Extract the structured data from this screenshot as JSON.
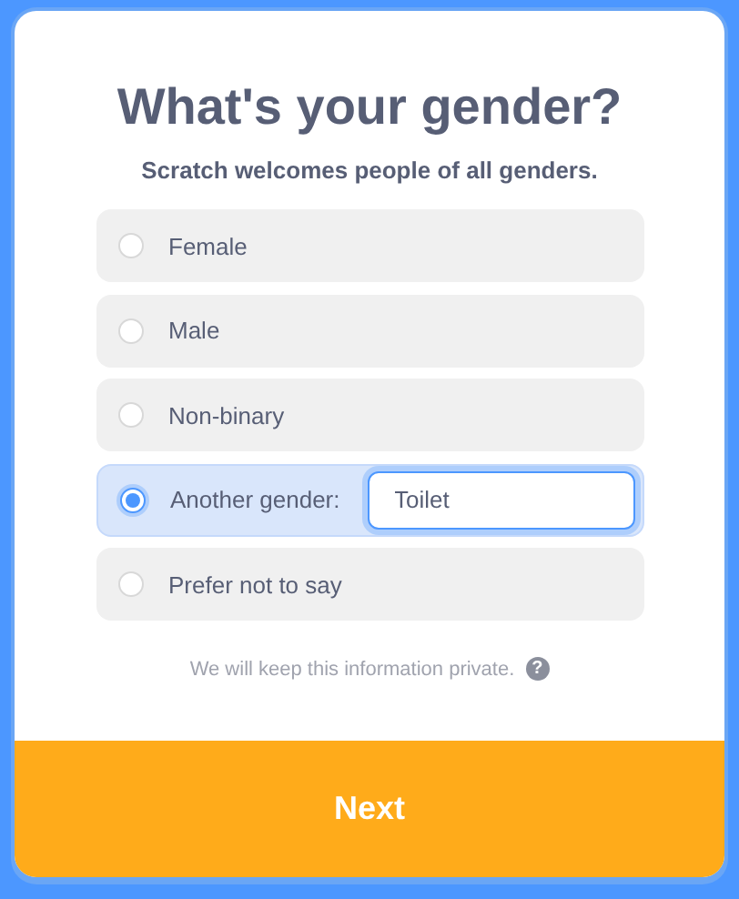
{
  "title": "What's your gender?",
  "subtitle": "Scratch welcomes people of all genders.",
  "options": [
    {
      "kind": "radio",
      "label": "Female",
      "selected": false
    },
    {
      "kind": "radio",
      "label": "Male",
      "selected": false
    },
    {
      "kind": "radio",
      "label": "Non-binary",
      "selected": false
    },
    {
      "kind": "custom",
      "label": "Another gender:",
      "selected": true,
      "value": "Toilet"
    },
    {
      "kind": "radio",
      "label": "Prefer not to say",
      "selected": false
    }
  ],
  "privacy_note": {
    "text": "We will keep this information private.",
    "help": "?"
  },
  "next_button": "Next"
}
